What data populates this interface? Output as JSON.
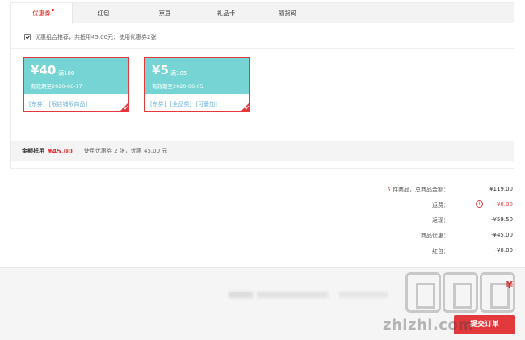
{
  "tabs": [
    {
      "label": "优惠券",
      "active": true
    },
    {
      "label": "红包",
      "active": false
    },
    {
      "label": "京豆",
      "active": false
    },
    {
      "label": "礼品卡",
      "active": false
    },
    {
      "label": "领货码",
      "active": false
    }
  ],
  "combo_recommend": {
    "checked": true,
    "text": "优惠组合推荐，共抵用45.00元；使用优惠券2张"
  },
  "coupons": [
    {
      "amount": "¥40",
      "condition": "满100",
      "validity": "有效期至2020-06-17",
      "tags": [
        "[东券]",
        "[限店铺限商品]"
      ],
      "selected": true
    },
    {
      "amount": "¥5",
      "condition": "满105",
      "validity": "有效期至2020-06-05",
      "tags": [
        "[东券]",
        "[全品类]",
        "[可叠加]"
      ],
      "selected": true
    }
  ],
  "summary": {
    "label": "金额抵用",
    "amount": "¥45.00",
    "description": "使用优惠券 2 张，优惠 45.00 元"
  },
  "totals": {
    "item_count": "5",
    "item_count_suffix": "件商品，总商品金额：",
    "goods_total": "¥119.00",
    "shipping_label": "运费：",
    "shipping_value": "¥0.00",
    "cashback_label": "返现：",
    "cashback_value": "-¥59.50",
    "discount_label": "商品优惠：",
    "discount_value": "-¥45.00",
    "redpacket_label": "红包：",
    "redpacket_value": "-¥0.00"
  },
  "footer": {
    "pay_amount": "¥",
    "submit_label": "提交订单"
  },
  "watermark": {
    "text": "zhizhi.com"
  },
  "colors": {
    "accent": "#e4393c",
    "coupon_bg": "#76d5d4",
    "link": "#6fb3d9"
  }
}
